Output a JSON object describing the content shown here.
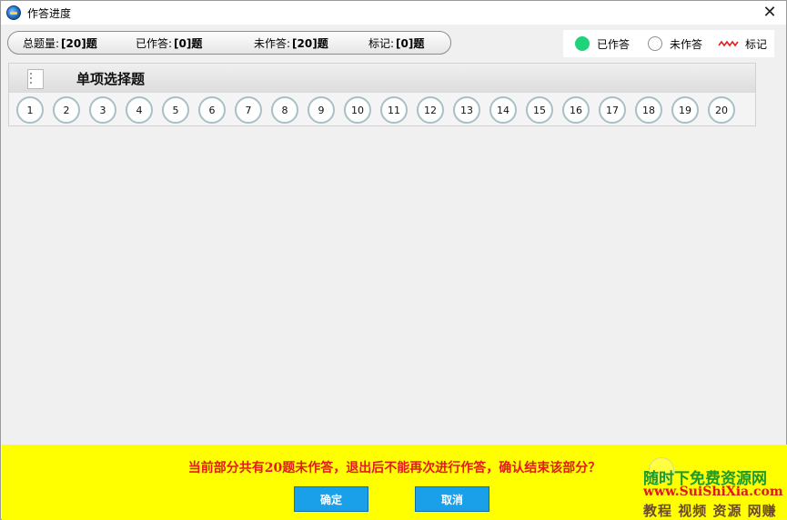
{
  "window": {
    "title": "作答进度",
    "close_glyph": "✕"
  },
  "stats": {
    "total_label": "总题量:",
    "total_value": "[20]题",
    "answered_label": "已作答:",
    "answered_value": "[0]题",
    "unanswered_label": "未作答:",
    "unanswered_value": "[20]题",
    "marked_label": "标记:",
    "marked_value": "[0]题"
  },
  "legend": {
    "answered": "已作答",
    "unanswered": "未作答",
    "marked": "标记"
  },
  "colors": {
    "answered": "#1fd37a",
    "footer": "#ffff00",
    "button": "#1aa0e8",
    "message": "#e31b1b",
    "mark": "#e02020"
  },
  "section": {
    "title": "单项选择题",
    "questions": [
      "1",
      "2",
      "3",
      "4",
      "5",
      "6",
      "7",
      "8",
      "9",
      "10",
      "11",
      "12",
      "13",
      "14",
      "15",
      "16",
      "17",
      "18",
      "19",
      "20"
    ]
  },
  "footer": {
    "message": "当前部分共有20题未作答，退出后不能再次进行作答，确认结束该部分？",
    "confirm_label": "确定",
    "cancel_label": "取消"
  },
  "watermark": {
    "line1": "随时下免费资源网",
    "line2": "www.SuiShiXia.com",
    "line3": "教程 视频 资源 网赚"
  }
}
